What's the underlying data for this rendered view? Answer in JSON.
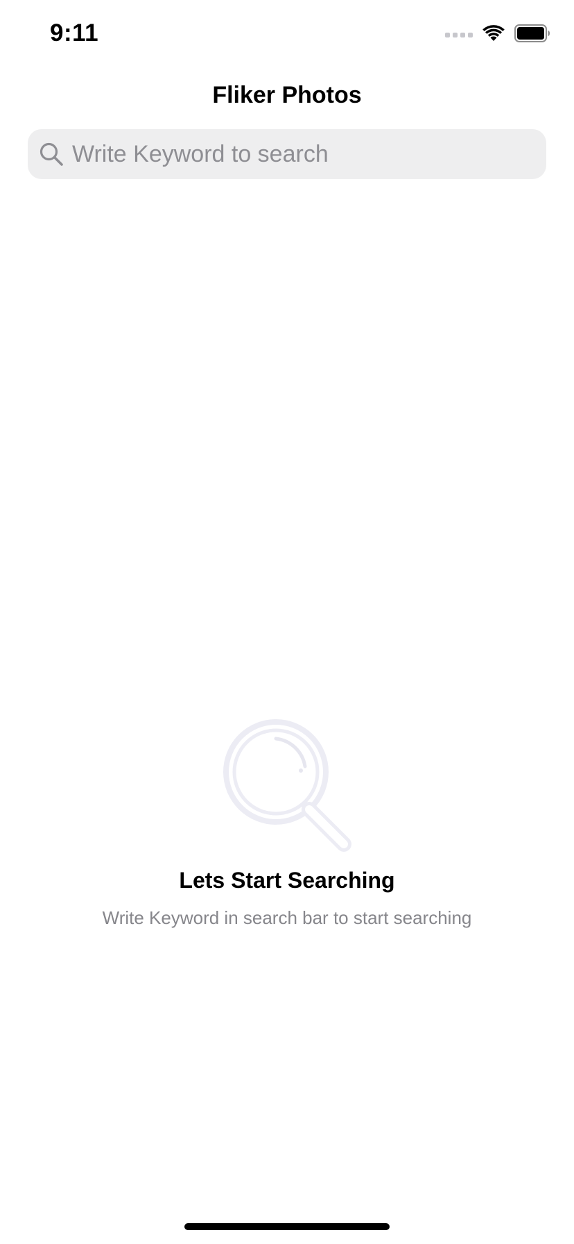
{
  "status_bar": {
    "time": "9:11",
    "icons": [
      "signal-icon",
      "wifi-icon",
      "battery-icon"
    ]
  },
  "nav": {
    "title": "Fliker Photos"
  },
  "search": {
    "placeholder": "Write Keyword to search",
    "value": "",
    "icon": "search-icon"
  },
  "empty_state": {
    "icon": "magnifier-illustration",
    "title": "Lets Start Searching",
    "subtitle": "Write Keyword in search bar to start searching"
  },
  "colors": {
    "background": "#ffffff",
    "search_bg": "#eeeeef",
    "placeholder": "#8e8e93",
    "subtitle": "#86868b",
    "illustration": "#ececf4"
  }
}
